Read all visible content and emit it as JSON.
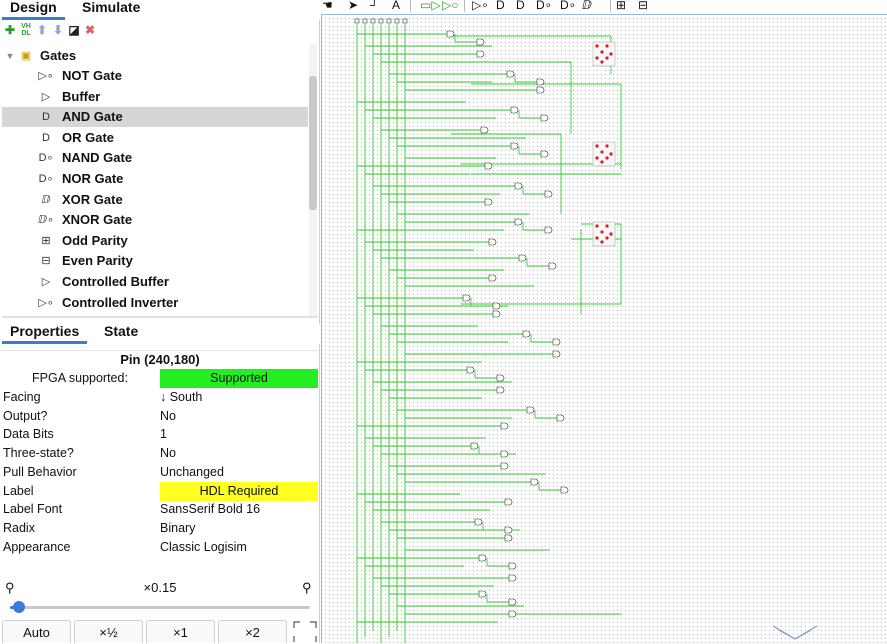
{
  "design_tabs": [
    {
      "label": "Design",
      "active": true
    },
    {
      "label": "Simulate",
      "active": false
    }
  ],
  "tree_toolbar": [
    {
      "name": "add-circuit-icon",
      "glyph": "✚",
      "color": "#2a9d2a"
    },
    {
      "name": "vhdl-icon",
      "glyph": "VH\nDL",
      "color": "#2a9d2a"
    },
    {
      "name": "move-up-icon",
      "glyph": "⬆",
      "color": "#8aa8e0"
    },
    {
      "name": "move-down-icon",
      "glyph": "⬇",
      "color": "#8aa8e0"
    },
    {
      "name": "appearance-icon",
      "glyph": "◪",
      "color": "#222222"
    },
    {
      "name": "delete-icon",
      "glyph": "✖",
      "color": "#e06060"
    }
  ],
  "tree": {
    "folder": {
      "label": "Gates",
      "expander": "▼"
    },
    "items": [
      {
        "label": "NOT Gate",
        "icon": "not-gate-icon",
        "glyph": "▷∘"
      },
      {
        "label": "Buffer",
        "icon": "buffer-icon",
        "glyph": "▷"
      },
      {
        "label": "AND Gate",
        "icon": "and-gate-icon",
        "glyph": "D",
        "selected": true
      },
      {
        "label": "OR Gate",
        "icon": "or-gate-icon",
        "glyph": "D"
      },
      {
        "label": "NAND Gate",
        "icon": "nand-gate-icon",
        "glyph": "D∘"
      },
      {
        "label": "NOR Gate",
        "icon": "nor-gate-icon",
        "glyph": "D∘"
      },
      {
        "label": "XOR Gate",
        "icon": "xor-gate-icon",
        "glyph": "ⅅ"
      },
      {
        "label": "XNOR Gate",
        "icon": "xnor-gate-icon",
        "glyph": "ⅅ∘"
      },
      {
        "label": "Odd Parity",
        "icon": "odd-parity-icon",
        "glyph": "⊞"
      },
      {
        "label": "Even Parity",
        "icon": "even-parity-icon",
        "glyph": "⊟"
      },
      {
        "label": "Controlled Buffer",
        "icon": "controlled-buffer-icon",
        "glyph": "▷"
      },
      {
        "label": "Controlled Inverter",
        "icon": "controlled-inverter-icon",
        "glyph": "▷∘"
      }
    ]
  },
  "prop_tabs": [
    {
      "label": "Properties",
      "active": true
    },
    {
      "label": "State",
      "active": false
    }
  ],
  "properties": {
    "title": "Pin (240,180)",
    "rows": [
      {
        "key": "FPGA supported:",
        "value": "Supported",
        "badge": "#22ee22",
        "center": true
      },
      {
        "key": "Facing",
        "value": "↓ South"
      },
      {
        "key": "Output?",
        "value": "No"
      },
      {
        "key": "Data Bits",
        "value": "1"
      },
      {
        "key": "Three-state?",
        "value": "No"
      },
      {
        "key": "Pull Behavior",
        "value": "Unchanged"
      },
      {
        "key": "Label",
        "value": "HDL Required",
        "badge": "#ffff22"
      },
      {
        "key": "Label Font",
        "value": "SansSerif Bold 16"
      },
      {
        "key": "Radix",
        "value": "Binary"
      },
      {
        "key": "Appearance",
        "value": "Classic Logisim"
      }
    ]
  },
  "zoom": {
    "label": "×0.15",
    "slider_fraction": 0.03,
    "buttons": [
      "Auto",
      "×½",
      "×1",
      "×2"
    ]
  },
  "toolbar": [
    {
      "name": "hand-tool-icon",
      "glyph": "☚"
    },
    {
      "name": "select-tool-icon",
      "glyph": "➤"
    },
    {
      "name": "wire-tool-icon",
      "glyph": "┘"
    },
    {
      "name": "text-tool-icon",
      "glyph": "A"
    },
    {
      "name": "input-pin-icon",
      "glyph": "▭▷"
    },
    {
      "name": "output-pin-icon",
      "glyph": "▷○"
    },
    {
      "name": "not-gate-tool-icon",
      "glyph": "▷∘"
    },
    {
      "name": "and-gate-tool-icon",
      "glyph": "D"
    },
    {
      "name": "or-gate-tool-icon",
      "glyph": "D"
    },
    {
      "name": "nand-gate-tool-icon",
      "glyph": "D∘"
    },
    {
      "name": "nor-gate-tool-icon",
      "glyph": "D∘"
    },
    {
      "name": "xor-gate-tool-icon",
      "glyph": "ⅅ"
    },
    {
      "name": "parity-tool-icon",
      "glyph": "⊞"
    },
    {
      "name": "parity2-tool-icon",
      "glyph": "⊟"
    }
  ],
  "colors": {
    "accent": "#3a7bd5",
    "wire": "#33cc33",
    "canvas_dots": "#b8b8b8",
    "led": "#d02020"
  }
}
